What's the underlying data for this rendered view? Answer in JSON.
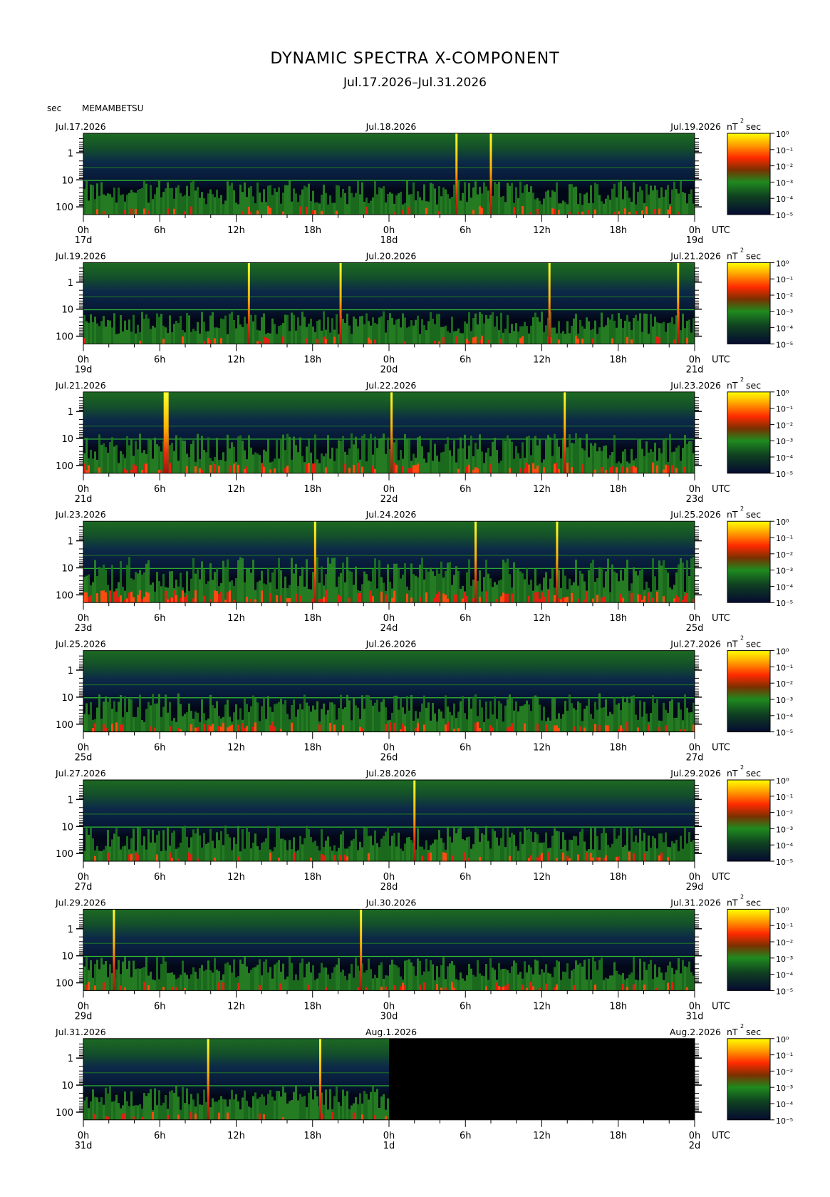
{
  "title": "DYNAMIC SPECTRA X-COMPONENT",
  "subtitle": "Jul.17.2026–Jul.31.2026",
  "y_axis_unit": "sec",
  "station": "MEMAMBETSU",
  "colorbar_unit": "nT",
  "colorbar_unit_exp": "2",
  "colorbar_unit_suffix": "sec",
  "colorbar_labels": [
    "10⁰",
    "10⁻¹",
    "10⁻²",
    "10⁻³",
    "10⁻⁴",
    "10⁻⁵"
  ],
  "colors": {
    "background": "#000000",
    "low": "#0b1440",
    "mid": "#1f7a1f",
    "high": "#e02010",
    "peak": "#ffff00",
    "line": "#2fbf2f"
  },
  "chart_data": {
    "type": "heatmap",
    "x_ticks": [
      "0h",
      "6h",
      "12h",
      "18h",
      "0h",
      "6h",
      "12h",
      "18h",
      "0h"
    ],
    "utc_label": "UTC",
    "y_ticks": [
      "1",
      "10",
      "100"
    ],
    "y_scale": "log",
    "panels": [
      {
        "left_date": "Jul.17.2026",
        "mid_date": "Jul.18.2026",
        "right_date": "Jul.19.2026",
        "day_labels": [
          "17d",
          "18d",
          "19d"
        ],
        "spikes_hours": [
          29.3,
          32.0
        ],
        "data_until_hours": 48,
        "activity": 0.35
      },
      {
        "left_date": "Jul.19.2026",
        "mid_date": "Jul.20.2026",
        "right_date": "Jul.21.2026",
        "day_labels": [
          "19d",
          "20d",
          "21d"
        ],
        "spikes_hours": [
          13.0,
          20.2,
          36.6,
          46.7
        ],
        "data_until_hours": 48,
        "activity": 0.3
      },
      {
        "left_date": "Jul.21.2026",
        "mid_date": "Jul.22.2026",
        "right_date": "Jul.23.2026",
        "day_labels": [
          "21d",
          "22d",
          "23d"
        ],
        "spikes_hours": [
          6.5,
          24.2,
          37.8
        ],
        "data_until_hours": 48,
        "activity": 0.55
      },
      {
        "left_date": "Jul.23.2026",
        "mid_date": "Jul.24.2026",
        "right_date": "Jul.25.2026",
        "day_labels": [
          "23d",
          "24d",
          "25d"
        ],
        "spikes_hours": [
          18.2,
          30.8,
          37.2
        ],
        "data_until_hours": 48,
        "activity": 0.75
      },
      {
        "left_date": "Jul.25.2026",
        "mid_date": "Jul.26.2026",
        "right_date": "Jul.27.2026",
        "day_labels": [
          "25d",
          "26d",
          "27d"
        ],
        "spikes_hours": [],
        "data_until_hours": 48,
        "activity": 0.5
      },
      {
        "left_date": "Jul.27.2026",
        "mid_date": "Jul.28.2026",
        "right_date": "Jul.29.2026",
        "day_labels": [
          "27d",
          "28d",
          "29d"
        ],
        "spikes_hours": [
          26.0
        ],
        "data_until_hours": 48,
        "activity": 0.4
      },
      {
        "left_date": "Jul.29.2026",
        "mid_date": "Jul.30.2026",
        "right_date": "Jul.31.2026",
        "day_labels": [
          "29d",
          "30d",
          "31d"
        ],
        "spikes_hours": [
          2.4,
          21.8
        ],
        "data_until_hours": 48,
        "activity": 0.35
      },
      {
        "left_date": "Jul.31.2026",
        "mid_date": "Aug.1.2026",
        "right_date": "Aug.2.2026",
        "day_labels": [
          "31d",
          "1d",
          "2d"
        ],
        "spikes_hours": [
          9.8,
          18.6
        ],
        "data_until_hours": 24,
        "activity": 0.35
      }
    ]
  }
}
